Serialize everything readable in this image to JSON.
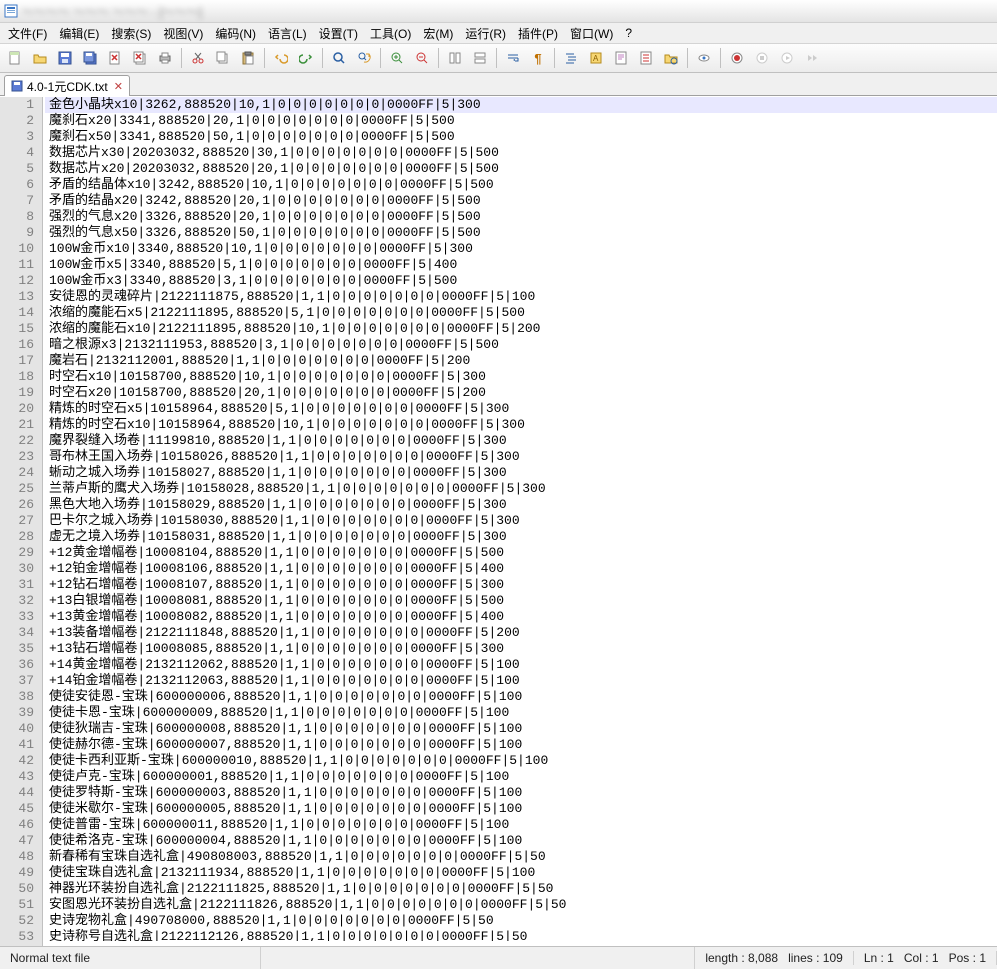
{
  "title_bar": {
    "title": "～～～～ ～～～ ～～～ - [～～～]"
  },
  "menu": {
    "file": "文件(F)",
    "edit": "编辑(E)",
    "search": "搜索(S)",
    "view": "视图(V)",
    "encoding": "编码(N)",
    "language": "语言(L)",
    "settings": "设置(T)",
    "tools": "工具(O)",
    "macro": "宏(M)",
    "run": "运行(R)",
    "plugins": "插件(P)",
    "window": "窗口(W)",
    "help": "?"
  },
  "toolbar": {
    "new": "new-file-icon",
    "open": "open-folder-icon",
    "save": "save-icon",
    "save_all": "save-all-icon",
    "close": "close-file-icon",
    "close_all": "close-all-icon",
    "print": "print-icon",
    "cut": "cut-icon",
    "copy": "copy-icon",
    "paste": "paste-icon",
    "undo": "undo-icon",
    "redo": "redo-icon",
    "find": "find-icon",
    "replace": "replace-icon",
    "zoom_in": "zoom-in-icon",
    "zoom_out": "zoom-out-icon",
    "sync_v": "sync-v-icon",
    "sync_h": "sync-h-icon",
    "wrap": "word-wrap-icon",
    "all_chars": "show-all-chars-icon",
    "indent": "indent-guide-icon",
    "lang": "user-lang-icon",
    "doc_map": "doc-map-icon",
    "func_list": "function-list-icon",
    "folder": "folder-as-workspace-icon",
    "monitor": "monitor-icon",
    "record": "macro-record-icon",
    "stop": "macro-stop-icon",
    "play": "macro-play-icon",
    "play_multi": "macro-play-multi-icon"
  },
  "tab": {
    "label": "4.0-1元CDK.txt",
    "modified": true
  },
  "lines": [
    "金色小晶块x10|3262,888520|10,1|0|0|0|0|0|0|0|0000FF|5|300",
    "魔刹石x20|3341,888520|20,1|0|0|0|0|0|0|0|0000FF|5|500",
    "魔刹石x50|3341,888520|50,1|0|0|0|0|0|0|0|0000FF|5|500",
    "数据芯片x30|20203032,888520|30,1|0|0|0|0|0|0|0|0000FF|5|500",
    "数据芯片x20|20203032,888520|20,1|0|0|0|0|0|0|0|0000FF|5|500",
    "矛盾的结晶体x10|3242,888520|10,1|0|0|0|0|0|0|0|0000FF|5|500",
    "矛盾的结晶x20|3242,888520|20,1|0|0|0|0|0|0|0|0000FF|5|500",
    "强烈的气息x20|3326,888520|20,1|0|0|0|0|0|0|0|0000FF|5|500",
    "强烈的气息x50|3326,888520|50,1|0|0|0|0|0|0|0|0000FF|5|500",
    "100W金币x10|3340,888520|10,1|0|0|0|0|0|0|0|0000FF|5|300",
    "100W金币x5|3340,888520|5,1|0|0|0|0|0|0|0|0000FF|5|400",
    "100W金币x3|3340,888520|3,1|0|0|0|0|0|0|0|0000FF|5|500",
    "安徒恩的灵魂碎片|2122111875,888520|1,1|0|0|0|0|0|0|0|0000FF|5|100",
    "浓缩的魔能石x5|2122111895,888520|5,1|0|0|0|0|0|0|0|0000FF|5|500",
    "浓缩的魔能石x10|2122111895,888520|10,1|0|0|0|0|0|0|0|0000FF|5|200",
    "暗之根源x3|2132111953,888520|3,1|0|0|0|0|0|0|0|0000FF|5|500",
    "魔岩石|2132112001,888520|1,1|0|0|0|0|0|0|0|0000FF|5|200",
    "时空石x10|10158700,888520|10,1|0|0|0|0|0|0|0|0000FF|5|300",
    "时空石x20|10158700,888520|20,1|0|0|0|0|0|0|0|0000FF|5|200",
    "精炼的时空石x5|10158964,888520|5,1|0|0|0|0|0|0|0|0000FF|5|300",
    "精炼的时空石x10|10158964,888520|10,1|0|0|0|0|0|0|0|0000FF|5|300",
    "魔界裂缝入场卷|11199810,888520|1,1|0|0|0|0|0|0|0|0000FF|5|300",
    "哥布林王国入场券|10158026,888520|1,1|0|0|0|0|0|0|0|0000FF|5|300",
    "蜥动之城入场券|10158027,888520|1,1|0|0|0|0|0|0|0|0000FF|5|300",
    "兰蒂卢斯的鹰犬入场券|10158028,888520|1,1|0|0|0|0|0|0|0|0000FF|5|300",
    "黑色大地入场券|10158029,888520|1,1|0|0|0|0|0|0|0|0000FF|5|300",
    "巴卡尔之城入场券|10158030,888520|1,1|0|0|0|0|0|0|0|0000FF|5|300",
    "虚无之境入场券|10158031,888520|1,1|0|0|0|0|0|0|0|0000FF|5|300",
    "+12黄金增幅卷|10008104,888520|1,1|0|0|0|0|0|0|0|0000FF|5|500",
    "+12铂金增幅卷|10008106,888520|1,1|0|0|0|0|0|0|0|0000FF|5|400",
    "+12钻石增幅卷|10008107,888520|1,1|0|0|0|0|0|0|0|0000FF|5|300",
    "+13白银增幅卷|10008081,888520|1,1|0|0|0|0|0|0|0|0000FF|5|500",
    "+13黄金增幅卷|10008082,888520|1,1|0|0|0|0|0|0|0|0000FF|5|400",
    "+13装备增幅卷|2122111848,888520|1,1|0|0|0|0|0|0|0|0000FF|5|200",
    "+13钻石增幅卷|10008085,888520|1,1|0|0|0|0|0|0|0|0000FF|5|300",
    "+14黄金增幅卷|2132112062,888520|1,1|0|0|0|0|0|0|0|0000FF|5|100",
    "+14铂金增幅卷|2132112063,888520|1,1|0|0|0|0|0|0|0|0000FF|5|100",
    "使徒安徒恩-宝珠|600000006,888520|1,1|0|0|0|0|0|0|0|0000FF|5|100",
    "使徒卡恩-宝珠|600000009,888520|1,1|0|0|0|0|0|0|0|0000FF|5|100",
    "使徒狄瑞吉-宝珠|600000008,888520|1,1|0|0|0|0|0|0|0|0000FF|5|100",
    "使徒赫尔德-宝珠|600000007,888520|1,1|0|0|0|0|0|0|0|0000FF|5|100",
    "使徒卡西利亚斯-宝珠|600000010,888520|1,1|0|0|0|0|0|0|0|0000FF|5|100",
    "使徒卢克-宝珠|600000001,888520|1,1|0|0|0|0|0|0|0|0000FF|5|100",
    "使徒罗特斯-宝珠|600000003,888520|1,1|0|0|0|0|0|0|0|0000FF|5|100",
    "使徒米歇尔-宝珠|600000005,888520|1,1|0|0|0|0|0|0|0|0000FF|5|100",
    "使徒普雷-宝珠|600000011,888520|1,1|0|0|0|0|0|0|0|0000FF|5|100",
    "使徒希洛克-宝珠|600000004,888520|1,1|0|0|0|0|0|0|0|0000FF|5|100",
    "新春稀有宝珠自选礼盒|490808003,888520|1,1|0|0|0|0|0|0|0|0000FF|5|50",
    "使徒宝珠自选礼盒|2132111934,888520|1,1|0|0|0|0|0|0|0|0000FF|5|100",
    "神器光环装扮自选礼盒|2122111825,888520|1,1|0|0|0|0|0|0|0|0000FF|5|50",
    "安图恩光环装扮自选礼盒|2122111826,888520|1,1|0|0|0|0|0|0|0|0000FF|5|50",
    "史诗宠物礼盒|490708000,888520|1,1|0|0|0|0|0|0|0|0000FF|5|50",
    "史诗称号自选礼盒|2122112126,888520|1,1|0|0|0|0|0|0|0|0000FF|5|50"
  ],
  "status": {
    "file_type": "Normal text file",
    "length_label": "length :",
    "length_value": "8,088",
    "lines_label": "lines :",
    "lines_value": "109",
    "ln_label": "Ln :",
    "ln_value": "1",
    "col_label": "Col :",
    "col_value": "1",
    "pos_label": "Pos :",
    "pos_value": "1"
  }
}
